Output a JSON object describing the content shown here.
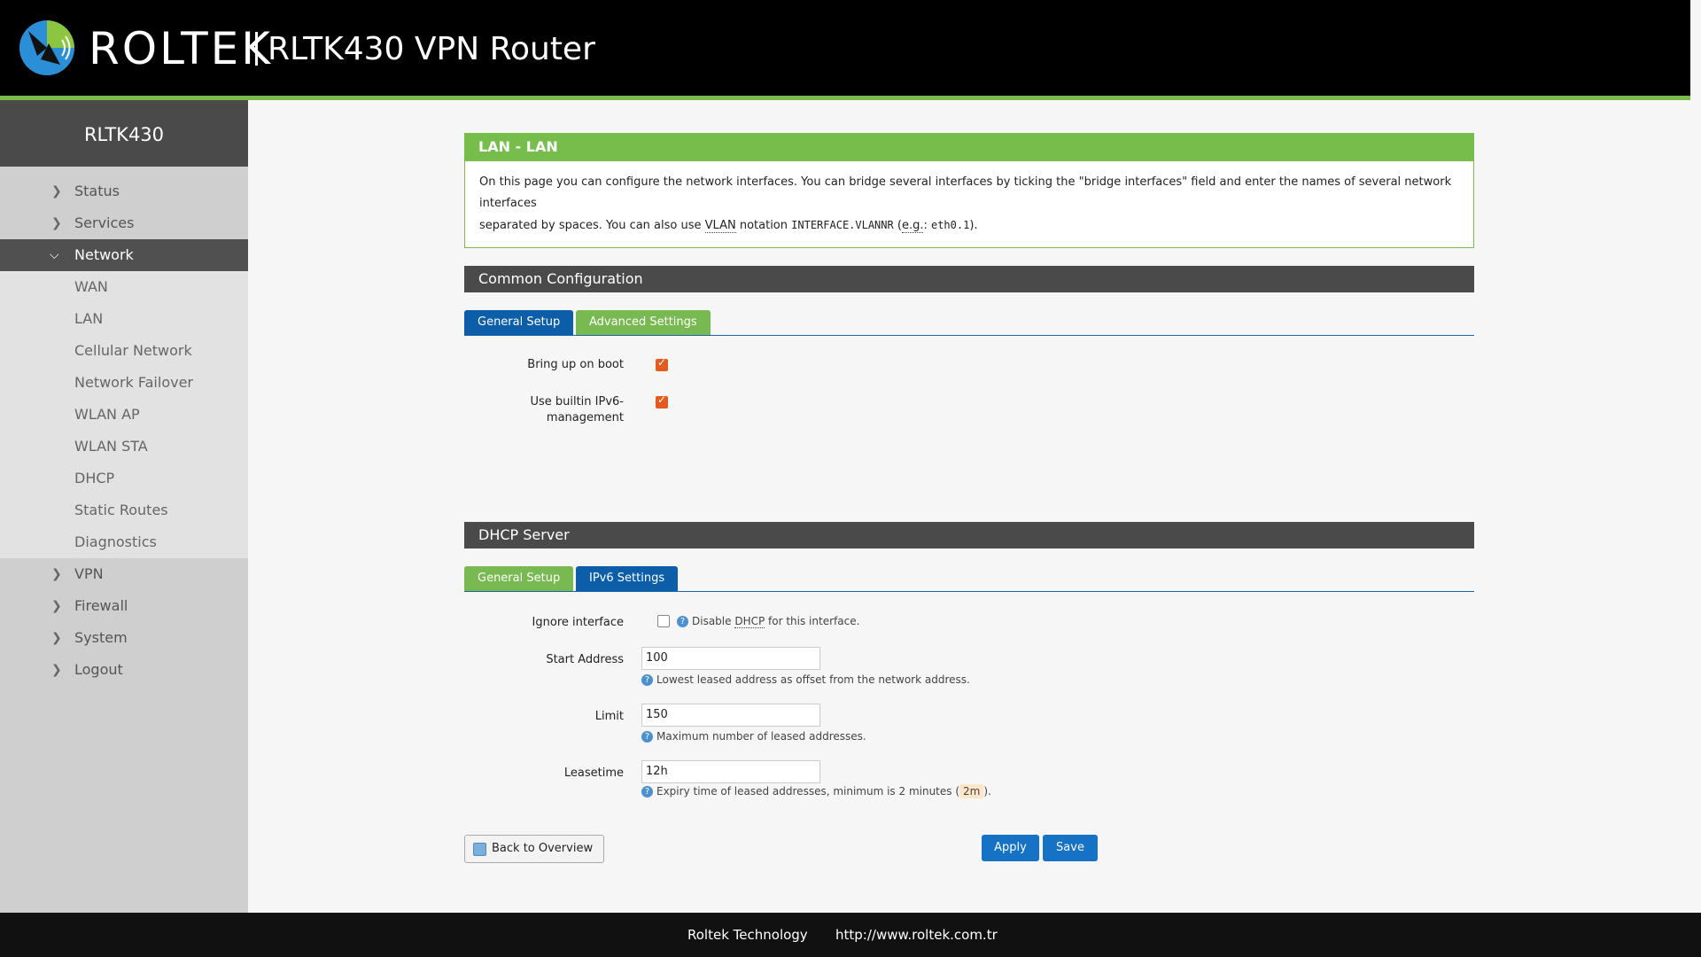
{
  "header": {
    "brand": "ROLTEK",
    "product": "RLTK430 VPN Router"
  },
  "sidebar": {
    "title": "RLTK430",
    "items": [
      {
        "label": "Status",
        "expanded": false
      },
      {
        "label": "Services",
        "expanded": false
      },
      {
        "label": "Network",
        "expanded": true,
        "active": true
      },
      {
        "label": "VPN",
        "expanded": false
      },
      {
        "label": "Firewall",
        "expanded": false
      },
      {
        "label": "System",
        "expanded": false
      },
      {
        "label": "Logout",
        "expanded": false
      }
    ],
    "network_sub": [
      "WAN",
      "LAN",
      "Cellular Network",
      "Network Failover",
      "WLAN AP",
      "WLAN STA",
      "DHCP",
      "Static Routes",
      "Diagnostics"
    ]
  },
  "page": {
    "title": "LAN - LAN",
    "desc_part1": "On this page you can configure the network interfaces. You can bridge several interfaces by ticking the \"bridge interfaces\" field and enter the names of several network interfaces",
    "desc_part2": "separated by spaces. You can also use ",
    "desc_vlan": "VLAN",
    "desc_part3": " notation ",
    "desc_code1": "INTERFACE.VLANNR",
    "desc_part4": " (",
    "desc_eg": "e.g.",
    "desc_part5": ": ",
    "desc_code2": "eth0.1",
    "desc_part6": ")."
  },
  "common": {
    "title": "Common Configuration",
    "tabs": [
      "General Setup",
      "Advanced Settings"
    ],
    "bring_up_label": "Bring up on boot",
    "bring_up_checked": true,
    "ipv6_label_1": "Use builtin IPv6-",
    "ipv6_label_2": "management",
    "ipv6_checked": true
  },
  "dhcp": {
    "title": "DHCP Server",
    "tabs": [
      "General Setup",
      "IPv6 Settings"
    ],
    "ignore_label": "Ignore interface",
    "ignore_checked": false,
    "ignore_hint_1": "Disable ",
    "ignore_hint_dhcp": "DHCP",
    "ignore_hint_2": " for this interface.",
    "start_label": "Start Address",
    "start_value": "100",
    "start_hint": "Lowest leased address as offset from the network address.",
    "limit_label": "Limit",
    "limit_value": "150",
    "limit_hint": "Maximum number of leased addresses.",
    "lease_label": "Leasetime",
    "lease_value": "12h",
    "lease_hint_1": "Expiry time of leased addresses, minimum is 2 minutes (",
    "lease_hint_code": "2m",
    "lease_hint_2": ")."
  },
  "actions": {
    "back": "Back to Overview",
    "apply": "Apply",
    "save": "Save"
  },
  "footer": {
    "company": "Roltek Technology",
    "url": "http://www.roltek.com.tr"
  },
  "colors": {
    "accent_green": "#77bd4b",
    "tab_blue": "#0c5ea9",
    "button_blue": "#1572c5",
    "checkbox_orange": "#e55a1e"
  }
}
